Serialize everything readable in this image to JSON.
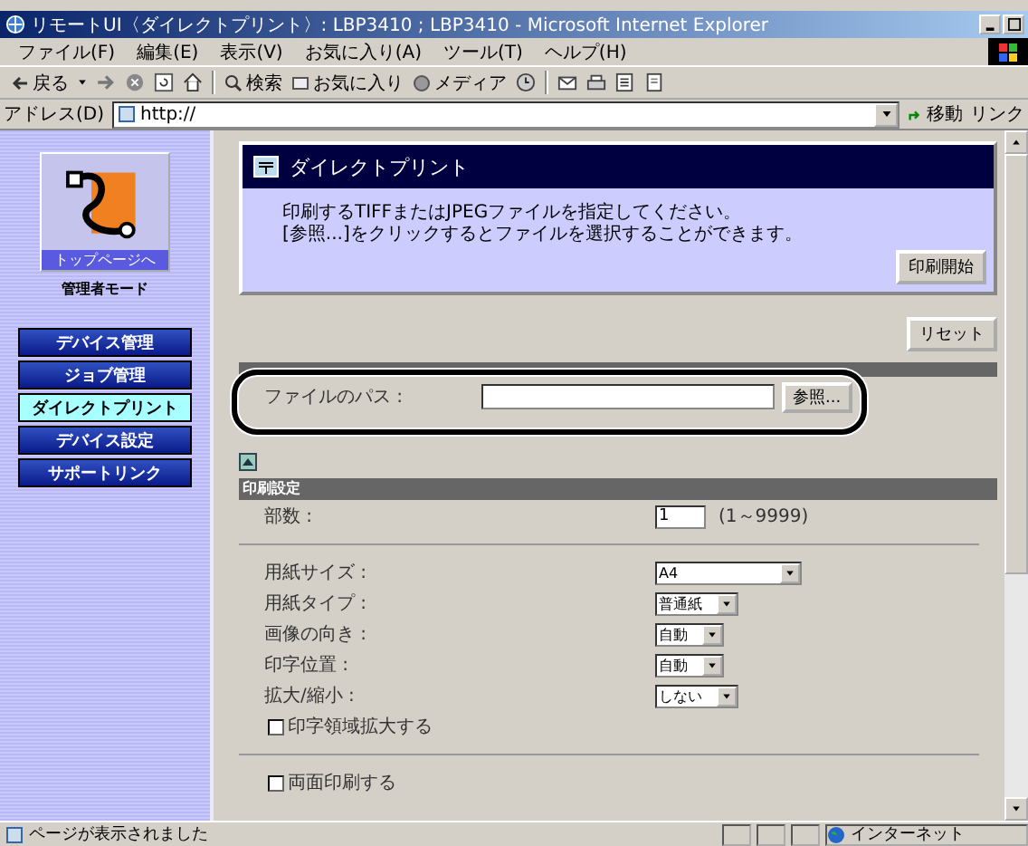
{
  "window": {
    "title": "リモートUI〈ダイレクトプリント〉: LBP3410 ; LBP3410 - Microsoft Internet Explorer"
  },
  "menu_bar": [
    "ファイル(F)",
    "編集(E)",
    "表示(V)",
    "お気に入り(A)",
    "ツール(T)",
    "ヘルプ(H)"
  ],
  "toolbar": {
    "back": "戻る",
    "search": "検索",
    "favorites": "お気に入り",
    "media": "メディア"
  },
  "address_bar": {
    "label": "アドレス(D)",
    "value": "http://",
    "go": "移動",
    "links": "リンク"
  },
  "sidebar": {
    "top_link": "トップページへ",
    "mode": "管理者モード",
    "items": [
      {
        "label": "デバイス管理",
        "selected": false
      },
      {
        "label": "ジョブ管理",
        "selected": false
      },
      {
        "label": "ダイレクトプリント",
        "selected": true
      },
      {
        "label": "デバイス設定",
        "selected": false
      },
      {
        "label": "サポートリンク",
        "selected": false
      }
    ]
  },
  "panel": {
    "title": "ダイレクトプリント",
    "description": [
      "印刷するTIFFまたはJPEGファイルを指定してください。",
      "[参照...]をクリックするとファイルを選択することができます。"
    ],
    "start_button": "印刷開始"
  },
  "reset_button": "リセット",
  "file_path": {
    "label": "ファイルのパス :",
    "browse_button": "参照..."
  },
  "print_settings": {
    "title": "印刷設定",
    "groups": [
      {
        "rows": [
          {
            "kind": "number",
            "label": "部数 :",
            "value": "1",
            "range": "(1～9999)"
          }
        ]
      },
      {
        "rows": [
          {
            "kind": "select",
            "label": "用紙サイズ :",
            "value": "A4"
          },
          {
            "kind": "select",
            "label": "用紙タイプ :",
            "value": "普通紙"
          },
          {
            "kind": "select",
            "label": "画像の向き :",
            "value": "自動"
          },
          {
            "kind": "select",
            "label": "印字位置 :",
            "value": "自動"
          },
          {
            "kind": "select",
            "label": "拡大/縮小 :",
            "value": "しない"
          },
          {
            "kind": "checkbox",
            "label": "印字領域拡大する",
            "checked": false
          }
        ]
      },
      {
        "rows": [
          {
            "kind": "checkbox",
            "label": "両面印刷する",
            "checked": false
          }
        ]
      }
    ]
  },
  "status_bar": {
    "text": "ページが表示されました",
    "zone": "インターネット"
  }
}
